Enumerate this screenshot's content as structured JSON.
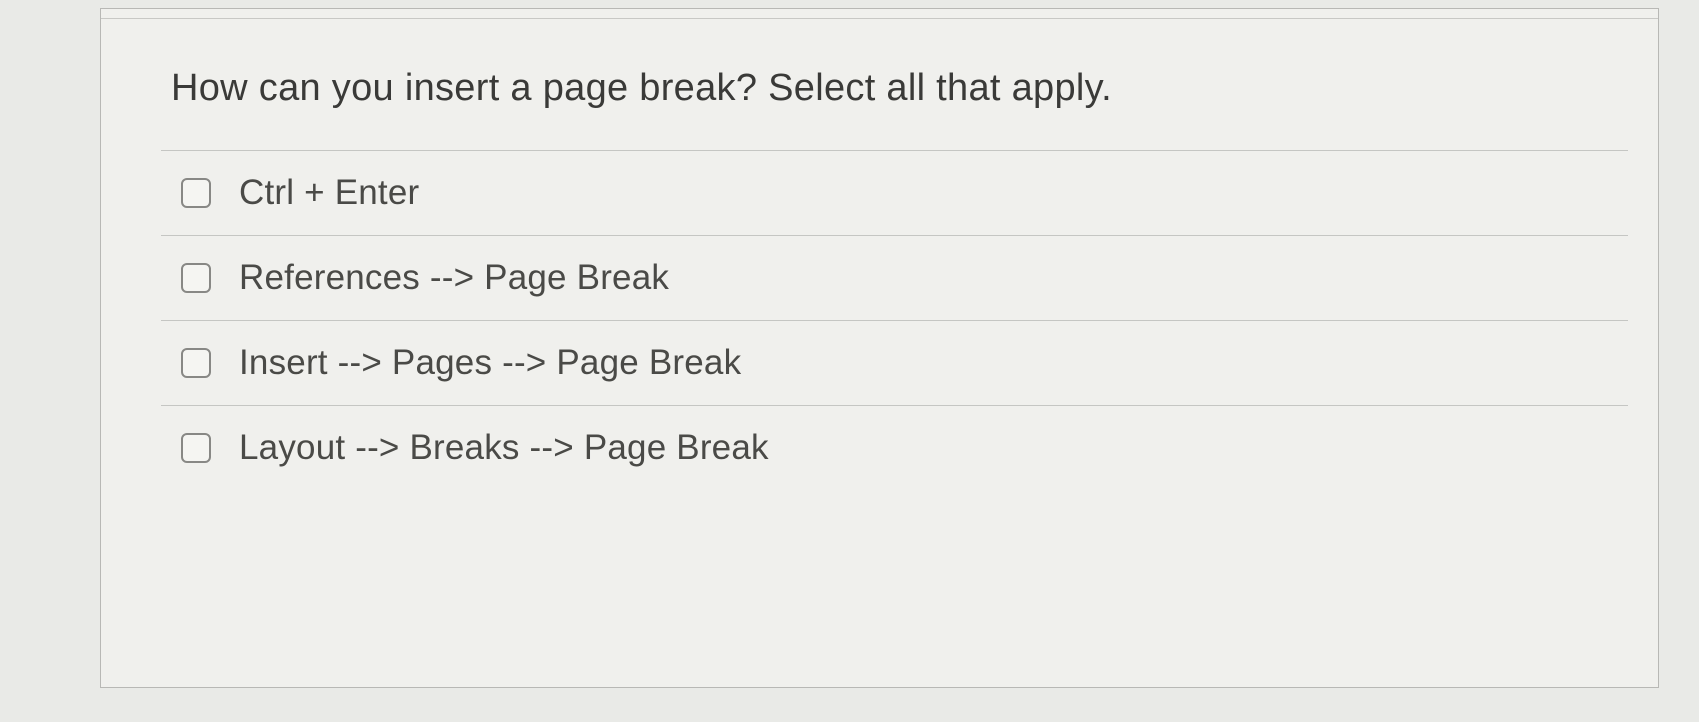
{
  "question": {
    "prompt": "How can you insert a page break?  Select all that apply.",
    "options": [
      {
        "label": "Ctrl + Enter"
      },
      {
        "label": "References --> Page Break"
      },
      {
        "label": "Insert --> Pages --> Page Break"
      },
      {
        "label": "Layout --> Breaks --> Page Break"
      }
    ]
  }
}
